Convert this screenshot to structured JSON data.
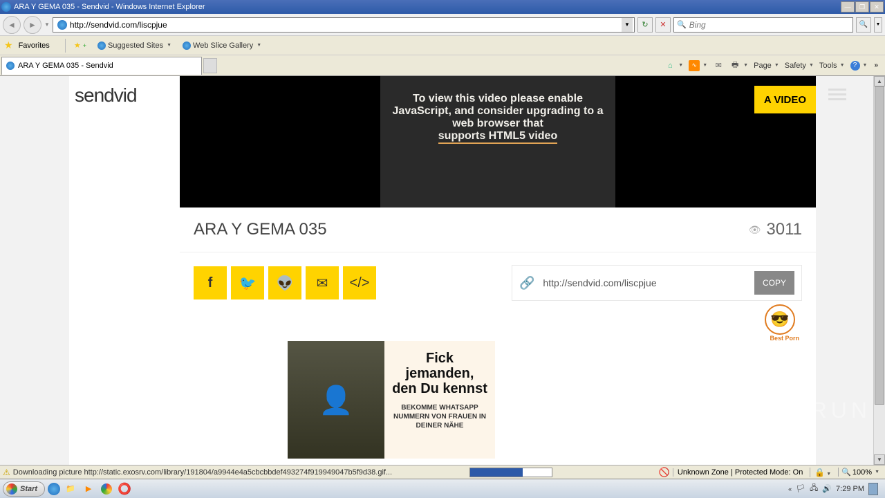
{
  "window": {
    "title": "ARA Y GEMA 035 - Sendvid - Windows Internet Explorer"
  },
  "navbar": {
    "url": "http://sendvid.com/liscpjue",
    "search_placeholder": "Bing",
    "refresh_glyph": "↻",
    "stop_glyph": "✕"
  },
  "favbar": {
    "label": "Favorites",
    "suggested": "Suggested Sites",
    "webslice": "Web Slice Gallery"
  },
  "tab": {
    "label": "ARA Y GEMA 035 - Sendvid"
  },
  "cmd": {
    "page": "Page",
    "safety": "Safety",
    "tools": "Tools"
  },
  "site": {
    "logo": "sendvid",
    "upload_label": "A VIDEO"
  },
  "video_msg": {
    "line1": "To view this video please enable JavaScript, and consider upgrading to a web browser that",
    "link": "supports HTML5 video"
  },
  "video": {
    "title": "ARA Y GEMA 035",
    "views": "3011",
    "url": "http://sendvid.com/liscpjue",
    "copy_label": "COPY"
  },
  "badge": {
    "label": "Best Porn"
  },
  "ad": {
    "headline": "Fick jemanden, den Du kennst",
    "sub": "BEKOMME WHATSAPP NUMMERN VON FRAUEN IN DEINER NÄHE"
  },
  "status": {
    "msg": "Downloading picture http://static.exosrv.com/library/191804/a9944e4a5cbcbbdef493274f919949047b5f9d38.gif...",
    "zone": "Unknown Zone | Protected Mode: On",
    "zoom": "100%"
  },
  "taskbar": {
    "start": "Start",
    "clock": "7:29 PM"
  },
  "watermark": {
    "text": "ANY    RUN"
  }
}
